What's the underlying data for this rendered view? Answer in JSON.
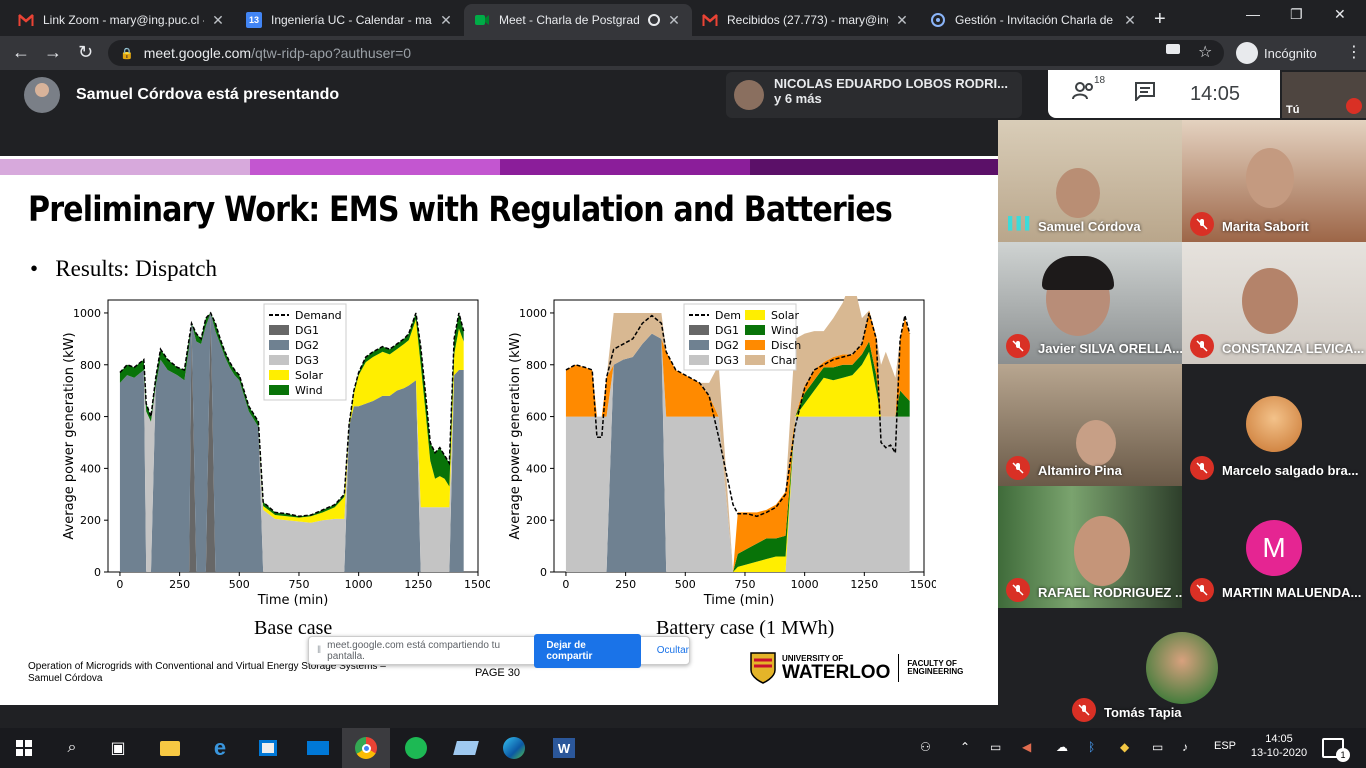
{
  "browser": {
    "tabs": [
      {
        "title": "Link Zoom - mary@ing.puc.cl -",
        "icon": "gmail-icon",
        "active": false
      },
      {
        "title": "Ingeniería UC - Calendar - mar",
        "icon": "calendar-icon",
        "active": false
      },
      {
        "title": "Meet - Charla de Postgrad",
        "icon": "meet-icon",
        "active": true
      },
      {
        "title": "Recibidos (27.773) - mary@ing",
        "icon": "gmail-icon",
        "active": false
      },
      {
        "title": "Gestión - Invitación Charla de",
        "icon": "loop-icon",
        "active": false
      }
    ],
    "calendar_badge": "13",
    "url_domain": "meet.google.com",
    "url_path": "/qtw-ridp-apo?authuser=0",
    "incognito_label": "Incógnito"
  },
  "meet": {
    "presenting_text": "Samuel Córdova está presentando",
    "pinned_name": "NICOLAS EDUARDO LOBOS RODRI...",
    "pinned_more": "y 6 más",
    "participant_count": "18",
    "clock": "14:05",
    "self_label": "Tú",
    "share_bar": {
      "text": "meet.google.com está compartiendo tu pantalla.",
      "stop_label": "Dejar de compartir",
      "hide_label": "Ocultar"
    },
    "participants": [
      {
        "name": "Samuel Córdova",
        "muted": false,
        "speaking": true
      },
      {
        "name": "Marita Saborit",
        "muted": true
      },
      {
        "name": "Javier SILVA ORELLA...",
        "muted": true
      },
      {
        "name": "CONSTANZA LEVICA...",
        "muted": true
      },
      {
        "name": "Altamiro Pina",
        "muted": true
      },
      {
        "name": "Marcelo salgado bra...",
        "muted": true
      },
      {
        "name": "RAFAEL RODRIGUEZ ...",
        "muted": true
      },
      {
        "name": "MARTIN MALUENDA...",
        "muted": true,
        "letter": "M"
      },
      {
        "name": "Tomás Tapia",
        "muted": true
      }
    ]
  },
  "slide": {
    "title": "Preliminary Work: EMS with Regulation and Batteries",
    "bullet": "Results: Dispatch",
    "caption_left": "Base case",
    "caption_right": "Battery case (1 MWh)",
    "footer": "Operation of Microgrids with Conventional and Virtual Energy Storage Systems – Samuel Córdova",
    "page": "PAGE  30",
    "logo_univ": "UNIVERSITY OF",
    "logo_name": "WATERLOO",
    "logo_fac1": "FACULTY OF",
    "logo_fac2": "ENGINEERING",
    "colors": {
      "dg1": "#676767",
      "dg2": "#6f8191",
      "dg3": "#c4c4c4",
      "solar": "#ffee00",
      "wind": "#087308",
      "disch": "#ff8a00",
      "char": "#d8b892"
    }
  },
  "chart_data": [
    {
      "type": "area",
      "title": "Base case",
      "xlabel": "Time (min)",
      "ylabel": "Average power generation (kW)",
      "xlim": [
        -50,
        1500
      ],
      "ylim": [
        0,
        1050
      ],
      "xticks": [
        0,
        250,
        500,
        750,
        1000,
        1250,
        1500
      ],
      "yticks": [
        0,
        200,
        400,
        600,
        800,
        1000
      ],
      "legend": [
        "Demand",
        "DG1",
        "DG2",
        "DG3",
        "Solar",
        "Wind"
      ],
      "legend_position": "top-center",
      "x": [
        0,
        30,
        60,
        100,
        110,
        130,
        150,
        170,
        200,
        240,
        270,
        290,
        300,
        320,
        340,
        360,
        380,
        400,
        420,
        440,
        460,
        480,
        500,
        520,
        540,
        560,
        580,
        600,
        650,
        700,
        750,
        800,
        850,
        900,
        940,
        960,
        980,
        1000,
        1030,
        1060,
        1100,
        1130,
        1160,
        1190,
        1210,
        1240,
        1260,
        1280,
        1300,
        1320,
        1340,
        1360,
        1380,
        1400,
        1420,
        1440
      ],
      "series": [
        {
          "name": "Demand",
          "values": [
            770,
            800,
            790,
            820,
            650,
            600,
            750,
            860,
            820,
            790,
            780,
            900,
            960,
            920,
            900,
            980,
            1000,
            960,
            900,
            850,
            810,
            780,
            760,
            700,
            640,
            610,
            580,
            270,
            230,
            225,
            215,
            220,
            240,
            260,
            300,
            570,
            700,
            770,
            830,
            850,
            870,
            860,
            880,
            900,
            920,
            1000,
            870,
            690,
            500,
            460,
            480,
            450,
            420,
            900,
            1000,
            930
          ]
        },
        {
          "name": "DG1",
          "values": [
            0,
            0,
            0,
            0,
            0,
            0,
            0,
            0,
            0,
            0,
            0,
            0,
            960,
            0,
            0,
            0,
            1000,
            0,
            0,
            0,
            0,
            0,
            0,
            0,
            0,
            0,
            0,
            0,
            0,
            0,
            0,
            0,
            0,
            0,
            0,
            0,
            0,
            0,
            0,
            0,
            0,
            0,
            0,
            0,
            0,
            0,
            0,
            0,
            0,
            0,
            0,
            0,
            0,
            0,
            0,
            0
          ]
        },
        {
          "name": "DG2",
          "values": [
            730,
            760,
            750,
            780,
            0,
            0,
            720,
            820,
            780,
            760,
            740,
            870,
            0,
            890,
            880,
            950,
            0,
            930,
            880,
            830,
            790,
            760,
            740,
            680,
            620,
            590,
            560,
            0,
            0,
            0,
            0,
            0,
            0,
            0,
            0,
            560,
            640,
            640,
            650,
            660,
            680,
            680,
            700,
            710,
            720,
            740,
            0,
            0,
            0,
            0,
            0,
            0,
            0,
            760,
            780,
            780
          ]
        },
        {
          "name": "DG3",
          "values": [
            0,
            0,
            0,
            0,
            620,
            580,
            0,
            0,
            0,
            0,
            0,
            0,
            0,
            0,
            0,
            0,
            0,
            0,
            0,
            0,
            0,
            0,
            0,
            0,
            0,
            0,
            0,
            240,
            205,
            200,
            195,
            190,
            200,
            205,
            205,
            0,
            0,
            0,
            0,
            0,
            0,
            0,
            0,
            0,
            0,
            0,
            250,
            250,
            250,
            250,
            250,
            250,
            250,
            0,
            0,
            0
          ]
        },
        {
          "name": "Solar",
          "values": [
            0,
            0,
            0,
            0,
            0,
            0,
            0,
            0,
            0,
            0,
            0,
            0,
            0,
            0,
            0,
            0,
            0,
            0,
            0,
            0,
            0,
            0,
            0,
            0,
            0,
            0,
            0,
            15,
            15,
            15,
            15,
            25,
            30,
            45,
            85,
            0,
            50,
            120,
            160,
            170,
            170,
            160,
            160,
            170,
            175,
            235,
            550,
            370,
            180,
            110,
            120,
            110,
            80,
            80,
            160,
            110
          ]
        },
        {
          "name": "Wind",
          "values": [
            40,
            40,
            40,
            40,
            30,
            20,
            30,
            40,
            40,
            30,
            40,
            30,
            0,
            30,
            20,
            30,
            0,
            30,
            20,
            20,
            20,
            20,
            20,
            20,
            20,
            20,
            20,
            15,
            10,
            10,
            5,
            5,
            10,
            10,
            10,
            10,
            10,
            10,
            20,
            20,
            20,
            20,
            20,
            20,
            25,
            25,
            70,
            70,
            70,
            100,
            110,
            90,
            90,
            60,
            60,
            40
          ]
        }
      ]
    },
    {
      "type": "area",
      "title": "Battery case (1 MWh)",
      "xlabel": "Time (min)",
      "ylabel": "Average power generation (kW)",
      "xlim": [
        -50,
        1500
      ],
      "ylim": [
        0,
        1050
      ],
      "xticks": [
        0,
        250,
        500,
        750,
        1000,
        1250,
        1500
      ],
      "yticks": [
        0,
        200,
        400,
        600,
        800,
        1000
      ],
      "legend": [
        "Dem",
        "DG1",
        "DG2",
        "DG3",
        "Solar",
        "Wind",
        "Disch",
        "Char"
      ],
      "legend_position": "top-center",
      "x": [
        0,
        40,
        80,
        110,
        130,
        150,
        170,
        200,
        240,
        280,
        320,
        360,
        400,
        420,
        460,
        500,
        560,
        600,
        640,
        700,
        720,
        760,
        800,
        840,
        880,
        920,
        960,
        1000,
        1040,
        1080,
        1120,
        1160,
        1200,
        1240,
        1270,
        1300,
        1320,
        1340,
        1360,
        1380,
        1400,
        1420,
        1440
      ],
      "series": [
        {
          "name": "Dem",
          "values": [
            780,
            800,
            790,
            780,
            520,
            520,
            750,
            860,
            880,
            900,
            960,
            990,
            960,
            850,
            780,
            760,
            730,
            680,
            520,
            260,
            225,
            225,
            215,
            230,
            250,
            300,
            560,
            710,
            780,
            800,
            820,
            830,
            840,
            880,
            1000,
            900,
            500,
            480,
            490,
            460,
            900,
            990,
            920
          ]
        },
        {
          "name": "DG2",
          "values": [
            0,
            0,
            0,
            0,
            0,
            0,
            0,
            800,
            820,
            830,
            880,
            920,
            900,
            0,
            0,
            0,
            0,
            0,
            0,
            0,
            0,
            0,
            0,
            0,
            0,
            0,
            0,
            0,
            0,
            0,
            0,
            0,
            0,
            0,
            0,
            0,
            0,
            0,
            0,
            0,
            0,
            0,
            0
          ]
        },
        {
          "name": "DG3",
          "values": [
            600,
            600,
            600,
            600,
            600,
            600,
            600,
            0,
            0,
            0,
            0,
            0,
            0,
            600,
            600,
            600,
            600,
            600,
            600,
            0,
            0,
            0,
            0,
            0,
            0,
            0,
            600,
            600,
            600,
            600,
            600,
            600,
            600,
            600,
            600,
            600,
            600,
            600,
            600,
            600,
            600,
            600,
            600
          ]
        },
        {
          "name": "Solar",
          "values": [
            0,
            0,
            0,
            0,
            0,
            0,
            0,
            0,
            0,
            0,
            0,
            0,
            0,
            0,
            0,
            0,
            0,
            0,
            0,
            0,
            20,
            30,
            40,
            50,
            60,
            60,
            0,
            50,
            100,
            150,
            140,
            150,
            160,
            200,
            250,
            100,
            0,
            0,
            0,
            0,
            0,
            0,
            0
          ]
        },
        {
          "name": "Wind",
          "values": [
            0,
            0,
            0,
            0,
            0,
            0,
            0,
            0,
            0,
            0,
            0,
            0,
            0,
            0,
            0,
            0,
            0,
            0,
            0,
            0,
            50,
            60,
            70,
            80,
            70,
            80,
            0,
            40,
            40,
            40,
            50,
            50,
            40,
            40,
            40,
            60,
            0,
            0,
            0,
            0,
            100,
            80,
            60
          ]
        },
        {
          "name": "Disch",
          "values": [
            180,
            200,
            190,
            180,
            0,
            0,
            150,
            0,
            0,
            0,
            0,
            0,
            0,
            250,
            180,
            160,
            130,
            80,
            0,
            0,
            160,
            140,
            120,
            110,
            130,
            170,
            0,
            30,
            40,
            20,
            40,
            40,
            40,
            40,
            120,
            150,
            0,
            0,
            0,
            0,
            200,
            300,
            260
          ]
        },
        {
          "name": "Char",
          "values": [
            0,
            0,
            0,
            0,
            0,
            0,
            0,
            200,
            180,
            170,
            120,
            80,
            100,
            0,
            0,
            0,
            0,
            50,
            200,
            0,
            0,
            0,
            0,
            0,
            0,
            0,
            300,
            200,
            150,
            120,
            150,
            200,
            300,
            100,
            0,
            0,
            200,
            250,
            200,
            150,
            0,
            0,
            0
          ]
        }
      ]
    }
  ],
  "taskbar": {
    "time": "14:05",
    "date": "13-10-2020",
    "lang": "ESP",
    "notif_count": "1"
  }
}
